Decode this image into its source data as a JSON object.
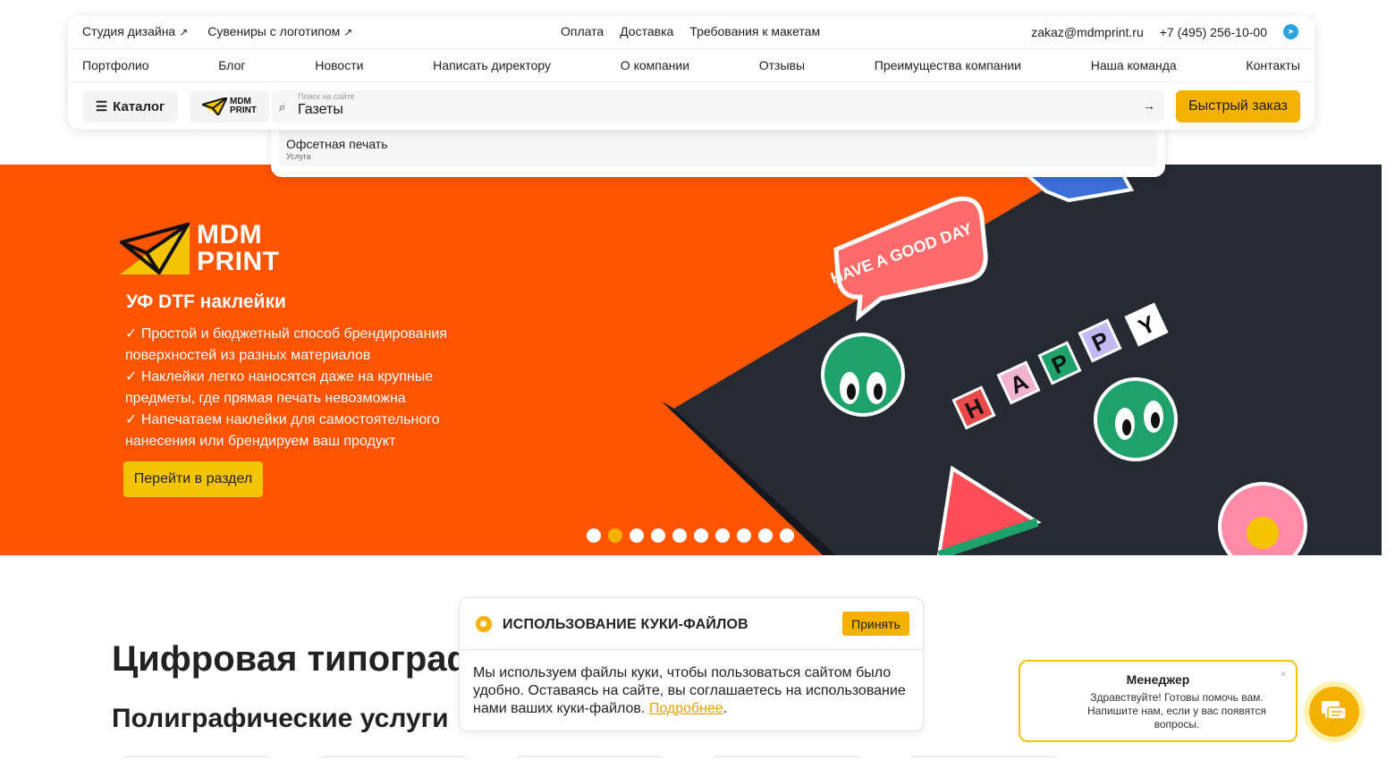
{
  "header": {
    "top_left": [
      {
        "label": "Студия дизайна",
        "arrow": "↗"
      },
      {
        "label": "Сувениры с логотипом",
        "arrow": "↗"
      }
    ],
    "top_mid": [
      "Оплата",
      "Доставка",
      "Требования к макетам"
    ],
    "email": "zakaz@mdmprint.ru",
    "phone": "+7 (495) 256-10-00",
    "telegram_icon": "telegram-icon",
    "nav": [
      "Портфолио",
      "Блог",
      "Новости",
      "Написать директору",
      "О компании",
      "Отзывы",
      "Преимущества компании",
      "Наша команда",
      "Контакты"
    ],
    "catalog_label": "Каталог",
    "logo_line1": "MDM",
    "logo_line2": "PRINT",
    "search": {
      "placeholder": "Поиск на сайте",
      "value": "Газеты"
    },
    "quick_order": "Быстрый заказ"
  },
  "suggest": {
    "items": [
      {
        "title": "Офсетная печать",
        "type": "Услуга"
      }
    ]
  },
  "hero": {
    "brand_line1": "MDM",
    "brand_line2": "PRINT",
    "title": "УФ DTF наклейки",
    "bullets": [
      "✓ Простой и бюджетный способ брендирования поверхностей из разных материалов",
      "✓ Наклейки легко наносятся даже на крупные предметы, где прямая печать невозможна",
      "✓ Напечатаем наклейки для самостоятельного нанесения или брендируем ваш продукт"
    ],
    "button": "Перейти в раздел",
    "slides_total": 10,
    "active_slide": 2,
    "sticker_text_1": "HAVE A GOOD DAY",
    "sticker_letters": [
      "H",
      "A",
      "P",
      "P",
      "Y"
    ]
  },
  "main": {
    "heading": "Цифровая типография",
    "subheading": "Полиграфические услуги"
  },
  "cookie": {
    "title": "ИСПОЛЬЗОВАНИЕ КУКИ-ФАЙЛОВ",
    "accept": "Принять",
    "text": "Мы используем файлы куки, чтобы пользоваться сайтом было удобно. Оставаясь на сайте, вы соглашаетесь на использование нами ваших куки-файлов.",
    "link": "Подробнее",
    "period": "."
  },
  "chat": {
    "title": "Менеджер",
    "close": "×",
    "message": "Здравствуйте! Готовы помочь вам. Напишите нам, если у вас появятся вопросы."
  },
  "colors": {
    "accent": "#f5b100",
    "hero_bg": "#ff5400",
    "telegram": "#2aa3e0"
  }
}
